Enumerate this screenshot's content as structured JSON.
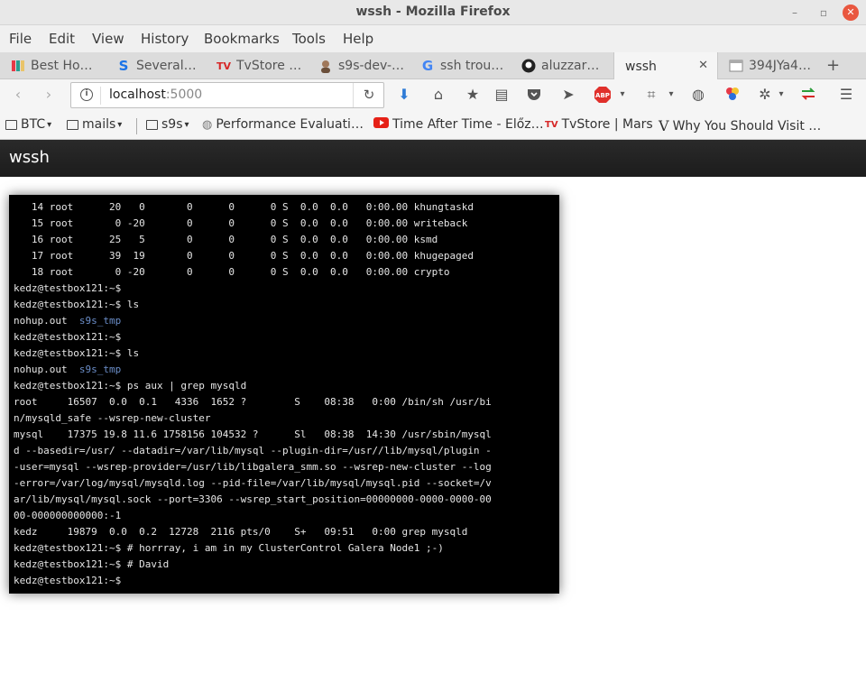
{
  "window": {
    "title": "wssh - Mozilla Firefox"
  },
  "menu": [
    "File",
    "Edit",
    "View",
    "History",
    "Bookmarks",
    "Tools",
    "Help"
  ],
  "tabs": [
    {
      "label": "Best Ho…",
      "icon": "colorful-favicon-icon",
      "active": false
    },
    {
      "label": "Several…",
      "icon": "s-logo-icon",
      "active": false
    },
    {
      "label": "TvStore …",
      "icon": "tvstore-icon",
      "active": false
    },
    {
      "label": "s9s-dev-…",
      "icon": "avatar-icon",
      "active": false
    },
    {
      "label": "ssh trou…",
      "icon": "google-icon",
      "active": false
    },
    {
      "label": "aluzzar…",
      "icon": "github-icon",
      "active": false
    },
    {
      "label": "wssh",
      "icon": "",
      "active": true
    },
    {
      "label": "394JYa4…",
      "icon": "page-icon",
      "active": false
    }
  ],
  "nav": {
    "url_host": "localhost",
    "url_port": ":5000"
  },
  "bookmarks": [
    {
      "label": "BTC",
      "type": "folder"
    },
    {
      "label": "mails",
      "type": "folder"
    },
    {
      "label": "s9s",
      "type": "folder"
    },
    {
      "label": "Performance Evaluati…",
      "type": "link",
      "icon": "globe-icon"
    },
    {
      "label": "Time After Time - Előz…",
      "type": "link",
      "icon": "youtube-icon"
    },
    {
      "label": "TvStore | Mars",
      "type": "link",
      "icon": "tvstore-icon"
    },
    {
      "label": "Why You Should Visit …",
      "type": "link",
      "icon": "v-logo-icon"
    }
  ],
  "app": {
    "brand": "wssh"
  },
  "terminal": {
    "lines": [
      {
        "text": "   14 root      20   0       0      0      0 S  0.0  0.0   0:00.00 khungtaskd"
      },
      {
        "text": "   15 root       0 -20       0      0      0 S  0.0  0.0   0:00.00 writeback"
      },
      {
        "text": "   16 root      25   5       0      0      0 S  0.0  0.0   0:00.00 ksmd"
      },
      {
        "text": "   17 root      39  19       0      0      0 S  0.0  0.0   0:00.00 khugepaged"
      },
      {
        "text": "   18 root       0 -20       0      0      0 S  0.0  0.0   0:00.00 crypto"
      },
      {
        "text": "kedz@testbox121:~$"
      },
      {
        "text": "kedz@testbox121:~$ ls"
      },
      {
        "text": "nohup.out  ",
        "blue": "s9s_tmp"
      },
      {
        "text": "kedz@testbox121:~$"
      },
      {
        "text": "kedz@testbox121:~$ ls"
      },
      {
        "text": "nohup.out  ",
        "blue": "s9s_tmp"
      },
      {
        "text": "kedz@testbox121:~$ ps aux | grep mysqld"
      },
      {
        "text": "root     16507  0.0  0.1   4336  1652 ?        S    08:38   0:00 /bin/sh /usr/bi"
      },
      {
        "text": "n/mysqld_safe --wsrep-new-cluster"
      },
      {
        "text": "mysql    17375 19.8 11.6 1758156 104532 ?      Sl   08:38  14:30 /usr/sbin/mysql"
      },
      {
        "text": "d --basedir=/usr/ --datadir=/var/lib/mysql --plugin-dir=/usr//lib/mysql/plugin -"
      },
      {
        "text": "-user=mysql --wsrep-provider=/usr/lib/libgalera_smm.so --wsrep-new-cluster --log"
      },
      {
        "text": "-error=/var/log/mysql/mysqld.log --pid-file=/var/lib/mysql/mysql.pid --socket=/v"
      },
      {
        "text": "ar/lib/mysql/mysql.sock --port=3306 --wsrep_start_position=00000000-0000-0000-00"
      },
      {
        "text": "00-000000000000:-1"
      },
      {
        "text": "kedz     19879  0.0  0.2  12728  2116 pts/0    S+   09:51   0:00 grep mysqld"
      },
      {
        "text": "kedz@testbox121:~$ # horrray, i am in my ClusterControl Galera Node1 ;-)"
      },
      {
        "text": "kedz@testbox121:~$ # David"
      },
      {
        "text": "kedz@testbox121:~$"
      }
    ]
  }
}
